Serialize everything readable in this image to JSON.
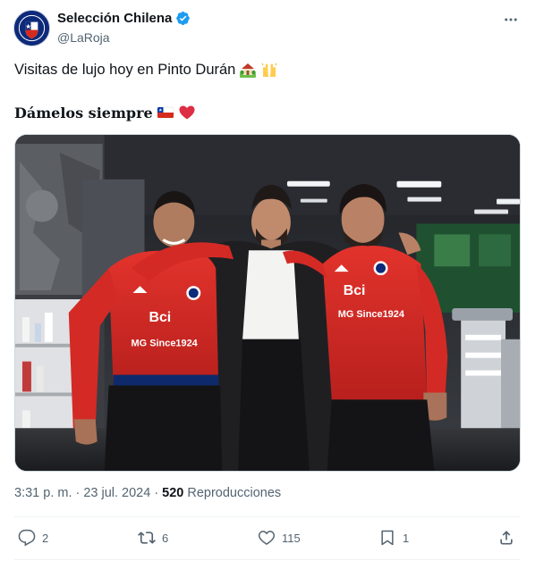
{
  "tweet": {
    "display_name": "Selección Chilena",
    "handle": "@LaRoja",
    "text_line1": "Visitas de lujo hoy en Pinto Durán",
    "text_line2": "Dámelos siempre",
    "time": "3:31 p. m.",
    "separator": "·",
    "date": "23 jul. 2024",
    "separator2": "·",
    "views_count": "520",
    "views_label": "Reproducciones"
  },
  "icons": {
    "avatar": "chile-federation-crest",
    "verified": "verified-badge-icon",
    "more": "more-options-icon",
    "house_emoji": "house-with-garden-emoji",
    "hands_emoji": "raising-hands-emoji",
    "flag_emoji": "chile-flag-emoji",
    "heart_emoji": "red-heart-emoji",
    "image": "photo-three-chile-players-locker-room"
  },
  "photo_text": {
    "sponsor": "Bci",
    "sponsor2": "MG Since1924"
  },
  "actions": {
    "reply_count": "2",
    "retweet_count": "6",
    "like_count": "115",
    "bookmark_count": "1"
  },
  "colors": {
    "accent": "#1d9bf0",
    "text_primary": "#0f1419",
    "text_secondary": "#536471",
    "jersey_red": "#d42a25"
  }
}
